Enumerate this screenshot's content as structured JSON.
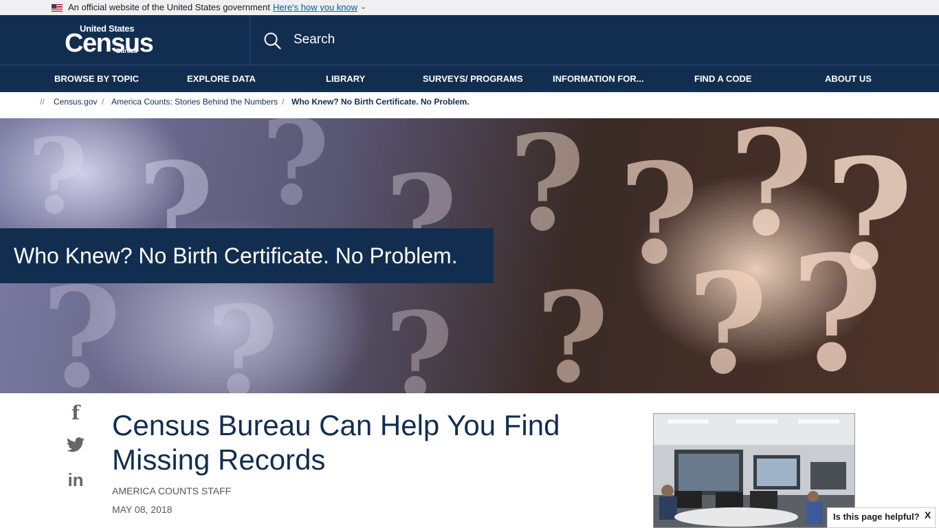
{
  "gov_banner": {
    "text": "An official website of the United States government",
    "link": "Here's how you know",
    "chevron": "⌄"
  },
  "header": {
    "logo": {
      "line1": "United States",
      "line2": "Census",
      "line3": "Bureau"
    },
    "search_label": "Search"
  },
  "nav": {
    "items": [
      {
        "label": "BROWSE BY TOPIC"
      },
      {
        "label": "EXPLORE DATA"
      },
      {
        "label": "LIBRARY"
      },
      {
        "label": "SURVEYS/ PROGRAMS"
      },
      {
        "label": "INFORMATION FOR..."
      },
      {
        "label": "FIND A CODE"
      },
      {
        "label": "ABOUT US"
      }
    ]
  },
  "breadcrumb": {
    "home_separator": "//",
    "separator": "/",
    "items": [
      "Census.gov",
      "America Counts: Stories Behind the Numbers",
      "Who Knew? No Birth Certificate. No Problem."
    ]
  },
  "hero": {
    "title": "Who Knew? No Birth Certificate. No Problem."
  },
  "share": {
    "facebook_glyph": "f",
    "linkedin_glyph": "in",
    "icons": [
      "facebook-icon",
      "twitter-icon",
      "linkedin-icon"
    ]
  },
  "article": {
    "title": "Census Bureau Can Help You Find Missing Records",
    "byline": "AMERICA COUNTS STAFF",
    "date": "MAY 08, 2018"
  },
  "feedback": {
    "question": "Is this page helpful?",
    "close": "X"
  },
  "colors": {
    "navy": "#112e51",
    "link_blue": "#005ea2",
    "banner_gray": "#f0f0f0"
  }
}
